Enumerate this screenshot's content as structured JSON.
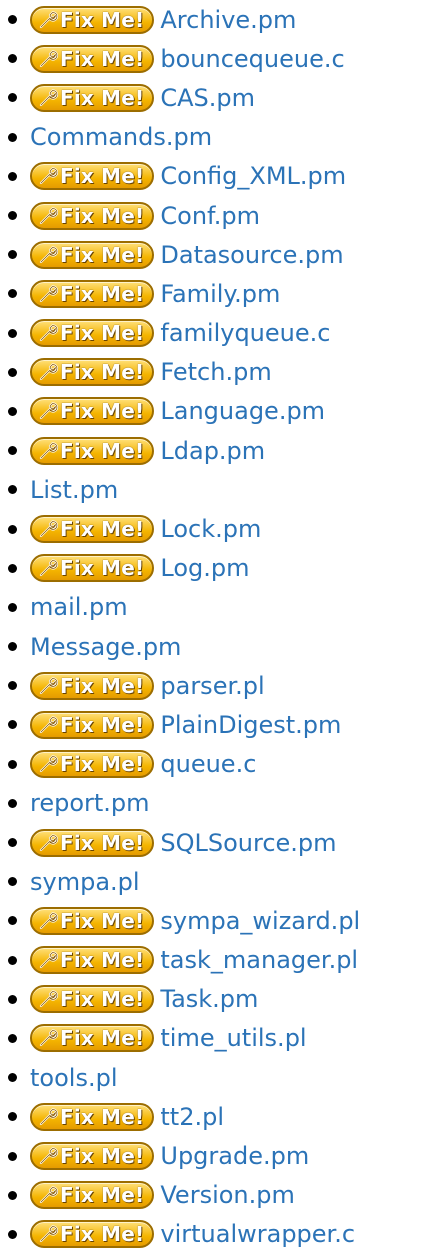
{
  "badge": {
    "label": "Fix Me!",
    "icon": "wrench-icon",
    "colors": {
      "fill": "#f4b400",
      "border": "#9c6d00",
      "text": "#ffffff"
    }
  },
  "link_color": "#2b73b7",
  "files": [
    {
      "name": "Archive.pm",
      "fixme": true
    },
    {
      "name": "bouncequeue.c",
      "fixme": true
    },
    {
      "name": "CAS.pm",
      "fixme": true
    },
    {
      "name": "Commands.pm",
      "fixme": false
    },
    {
      "name": "Config_XML.pm",
      "fixme": true
    },
    {
      "name": "Conf.pm",
      "fixme": true
    },
    {
      "name": "Datasource.pm",
      "fixme": true
    },
    {
      "name": "Family.pm",
      "fixme": true
    },
    {
      "name": "familyqueue.c",
      "fixme": true
    },
    {
      "name": "Fetch.pm",
      "fixme": true
    },
    {
      "name": "Language.pm",
      "fixme": true
    },
    {
      "name": "Ldap.pm",
      "fixme": true
    },
    {
      "name": "List.pm",
      "fixme": false
    },
    {
      "name": "Lock.pm",
      "fixme": true
    },
    {
      "name": "Log.pm",
      "fixme": true
    },
    {
      "name": "mail.pm",
      "fixme": false
    },
    {
      "name": "Message.pm",
      "fixme": false
    },
    {
      "name": "parser.pl",
      "fixme": true
    },
    {
      "name": "PlainDigest.pm",
      "fixme": true
    },
    {
      "name": "queue.c",
      "fixme": true
    },
    {
      "name": "report.pm",
      "fixme": false
    },
    {
      "name": "SQLSource.pm",
      "fixme": true
    },
    {
      "name": "sympa.pl",
      "fixme": false
    },
    {
      "name": "sympa_wizard.pl",
      "fixme": true
    },
    {
      "name": "task_manager.pl",
      "fixme": true
    },
    {
      "name": "Task.pm",
      "fixme": true
    },
    {
      "name": "time_utils.pl",
      "fixme": true
    },
    {
      "name": "tools.pl",
      "fixme": false
    },
    {
      "name": "tt2.pl",
      "fixme": true
    },
    {
      "name": "Upgrade.pm",
      "fixme": true
    },
    {
      "name": "Version.pm",
      "fixme": true
    },
    {
      "name": "virtualwrapper.c",
      "fixme": true
    }
  ]
}
